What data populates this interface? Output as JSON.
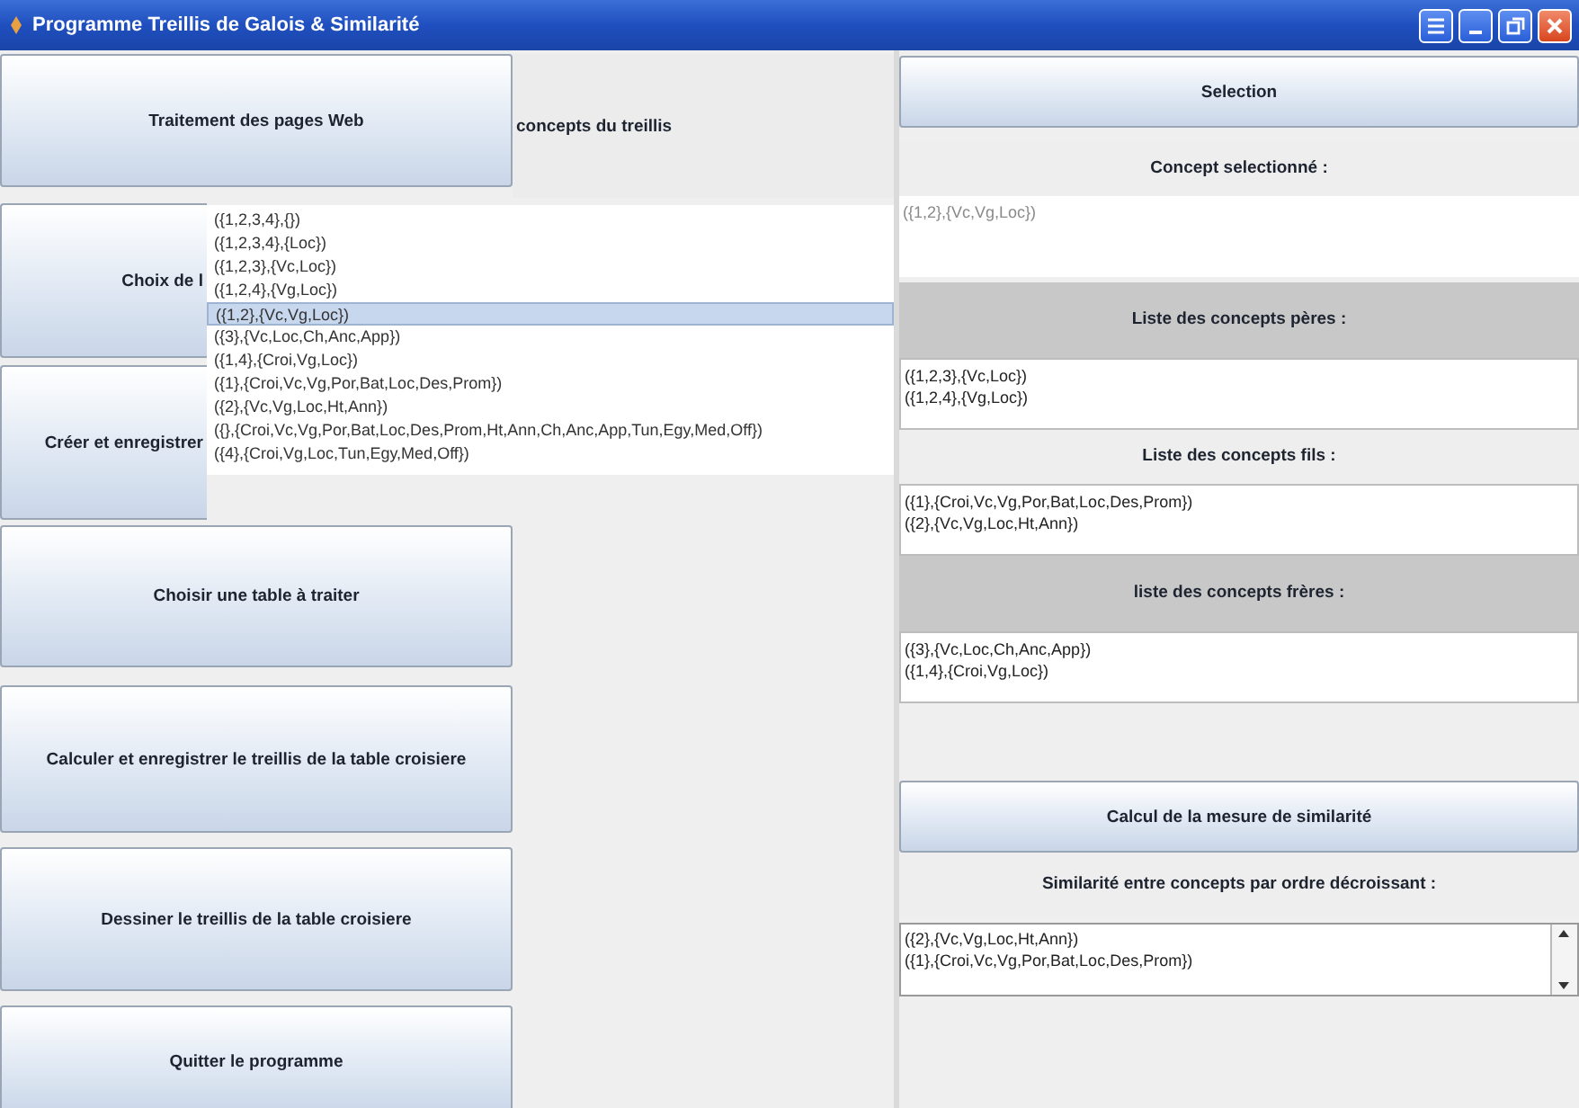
{
  "window": {
    "title": "Programme Treillis de Galois & Similarité"
  },
  "left_panel": {
    "buttons": [
      {
        "kind": "plain",
        "label": "Traitement des pages Web"
      },
      {
        "kind": "covered",
        "label": "Choix de l"
      },
      {
        "kind": "covered",
        "label": "Créer et enregistrer"
      },
      {
        "kind": "plain",
        "label": "Choisir une table à traiter"
      },
      {
        "kind": "plain",
        "label": "Calculer et enregistrer le treillis de la table croisiere"
      },
      {
        "kind": "plain",
        "label": "Dessiner le treillis de la table croisiere"
      },
      {
        "kind": "plain",
        "label": "Quitter le programme"
      }
    ],
    "concepts_label": "concepts du treillis",
    "concepts_list": [
      {
        "text": "({1,2,3,4},{})",
        "selected": false
      },
      {
        "text": "({1,2,3,4},{Loc})",
        "selected": false
      },
      {
        "text": "({1,2,3},{Vc,Loc})",
        "selected": false
      },
      {
        "text": "({1,2,4},{Vg,Loc})",
        "selected": false
      },
      {
        "text": "({1,2},{Vc,Vg,Loc})",
        "selected": true
      },
      {
        "text": "({3},{Vc,Loc,Ch,Anc,App})",
        "selected": false
      },
      {
        "text": "({1,4},{Croi,Vg,Loc})",
        "selected": false
      },
      {
        "text": "({1},{Croi,Vc,Vg,Por,Bat,Loc,Des,Prom})",
        "selected": false
      },
      {
        "text": "({2},{Vc,Vg,Loc,Ht,Ann})",
        "selected": false
      },
      {
        "text": "({},{Croi,Vc,Vg,Por,Bat,Loc,Des,Prom,Ht,Ann,Ch,Anc,App,Tun,Egy,Med,Off})",
        "selected": false
      },
      {
        "text": "({4},{Croi,Vg,Loc,Tun,Egy,Med,Off})",
        "selected": false
      }
    ]
  },
  "right_panel": [
    {
      "kind": "button",
      "label": "Selection"
    },
    {
      "kind": "label",
      "text": "Concept selectionné :"
    },
    {
      "kind": "text_box",
      "value": "({1,2},{Vc,Vg,Loc})"
    },
    {
      "kind": "header",
      "text": "Liste des concepts pères :"
    },
    {
      "kind": "list",
      "lines": [
        "({1,2,3},{Vc,Loc})",
        "({1,2,4},{Vg,Loc})"
      ]
    },
    {
      "kind": "label",
      "text": "Liste des concepts fils :"
    },
    {
      "kind": "list",
      "lines": [
        "({1},{Croi,Vc,Vg,Por,Bat,Loc,Des,Prom})",
        "({2},{Vc,Vg,Loc,Ht,Ann})"
      ]
    },
    {
      "kind": "header",
      "text": "liste des concepts frères :"
    },
    {
      "kind": "list",
      "lines": [
        "({3},{Vc,Loc,Ch,Anc,App})",
        "({1,4},{Croi,Vg,Loc})"
      ]
    },
    {
      "kind": "button",
      "label": "Calcul de la mesure de similarité"
    },
    {
      "kind": "label",
      "text": "Similarité entre concepts par ordre décroissant :"
    },
    {
      "kind": "scroll_list",
      "lines": [
        "({2},{Vc,Vg,Loc,Ht,Ann})",
        "({1},{Croi,Vc,Vg,Por,Bat,Loc,Des,Prom})"
      ]
    }
  ]
}
